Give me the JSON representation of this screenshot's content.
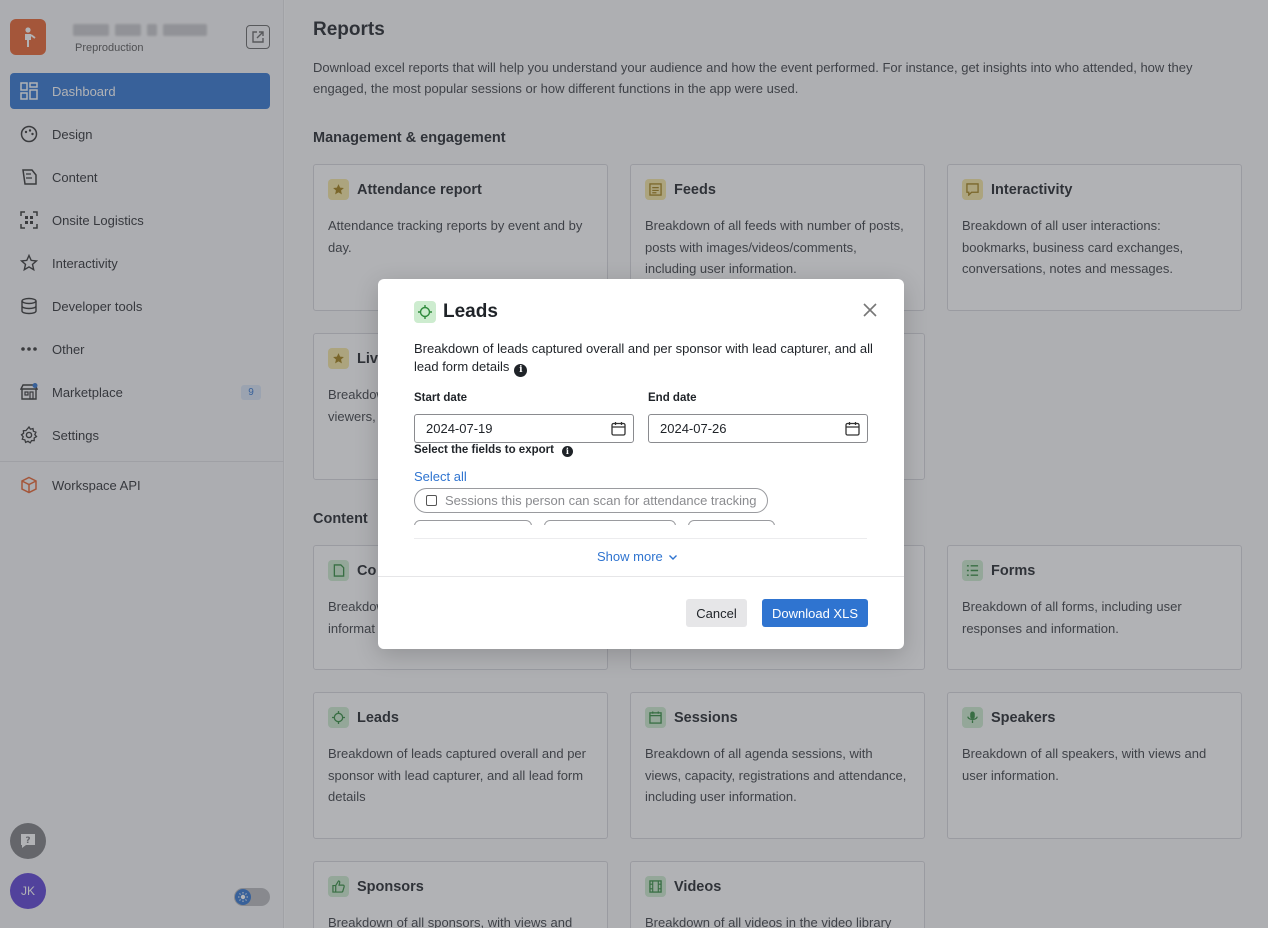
{
  "sidebar": {
    "org_env": "Preproduction",
    "items": [
      {
        "label": "Dashboard",
        "icon": "dashboard-icon"
      },
      {
        "label": "Design",
        "icon": "palette-icon"
      },
      {
        "label": "Content",
        "icon": "content-icon"
      },
      {
        "label": "Onsite Logistics",
        "icon": "qr-icon"
      },
      {
        "label": "Interactivity",
        "icon": "star-icon"
      },
      {
        "label": "Developer tools",
        "icon": "database-icon"
      },
      {
        "label": "Other",
        "icon": "more-icon"
      },
      {
        "label": "Marketplace",
        "icon": "store-icon",
        "badge": "9"
      },
      {
        "label": "Settings",
        "icon": "gear-icon"
      }
    ],
    "workspace_api": "Workspace API",
    "avatar_initials": "JK"
  },
  "main": {
    "title": "Reports",
    "description": "Download excel reports that will help you understand your audience and how the event performed. For instance, get insights into who attended, how they engaged, the most popular sessions or how different functions in the app were used.",
    "section_management": "Management & engagement",
    "section_content": "Content",
    "cards": {
      "attendance": {
        "title": "Attendance report",
        "desc": "Attendance tracking reports by event and by day."
      },
      "feeds": {
        "title": "Feeds",
        "desc": "Breakdown of all feeds with number of posts, posts with images/videos/comments, including user information."
      },
      "interactivity": {
        "title": "Interactivity",
        "desc": "Breakdown of all user interactions: bookmarks, business card exchanges, conversations, notes and messages."
      },
      "live": {
        "title": "Liv",
        "desc": "Breakdow viewers,"
      },
      "content": {
        "title": "Co",
        "desc": "Breakdow informat"
      },
      "forms": {
        "title": "Forms",
        "desc": "Breakdown of all forms, including user responses and information."
      },
      "leads": {
        "title": "Leads",
        "desc": "Breakdown of leads captured overall and per sponsor with lead capturer, and all lead form details"
      },
      "sessions": {
        "title": "Sessions",
        "desc": "Breakdown of all agenda sessions, with views, capacity, registrations and attendance, including user information."
      },
      "speakers": {
        "title": "Speakers",
        "desc": "Breakdown of all speakers, with views and user information."
      },
      "sponsors": {
        "title": "Sponsors",
        "desc": "Breakdown of all sponsors, with views and"
      },
      "videos": {
        "title": "Videos",
        "desc": "Breakdown of all videos in the video library"
      }
    }
  },
  "modal": {
    "title": "Leads",
    "description": "Breakdown of leads captured overall and per sponsor with lead capturer, and all lead form details",
    "start_label": "Start date",
    "start_value": "2024-07-19",
    "end_label": "End date",
    "end_value": "2024-07-26",
    "fields_label": "Select the fields to export",
    "select_all": "Select all",
    "chip_label": "Sessions this person can scan for attendance tracking",
    "show_more": "Show more",
    "cancel": "Cancel",
    "download": "Download XLS"
  },
  "colors": {
    "accent": "#2f74d0",
    "brand": "#e8612c"
  }
}
